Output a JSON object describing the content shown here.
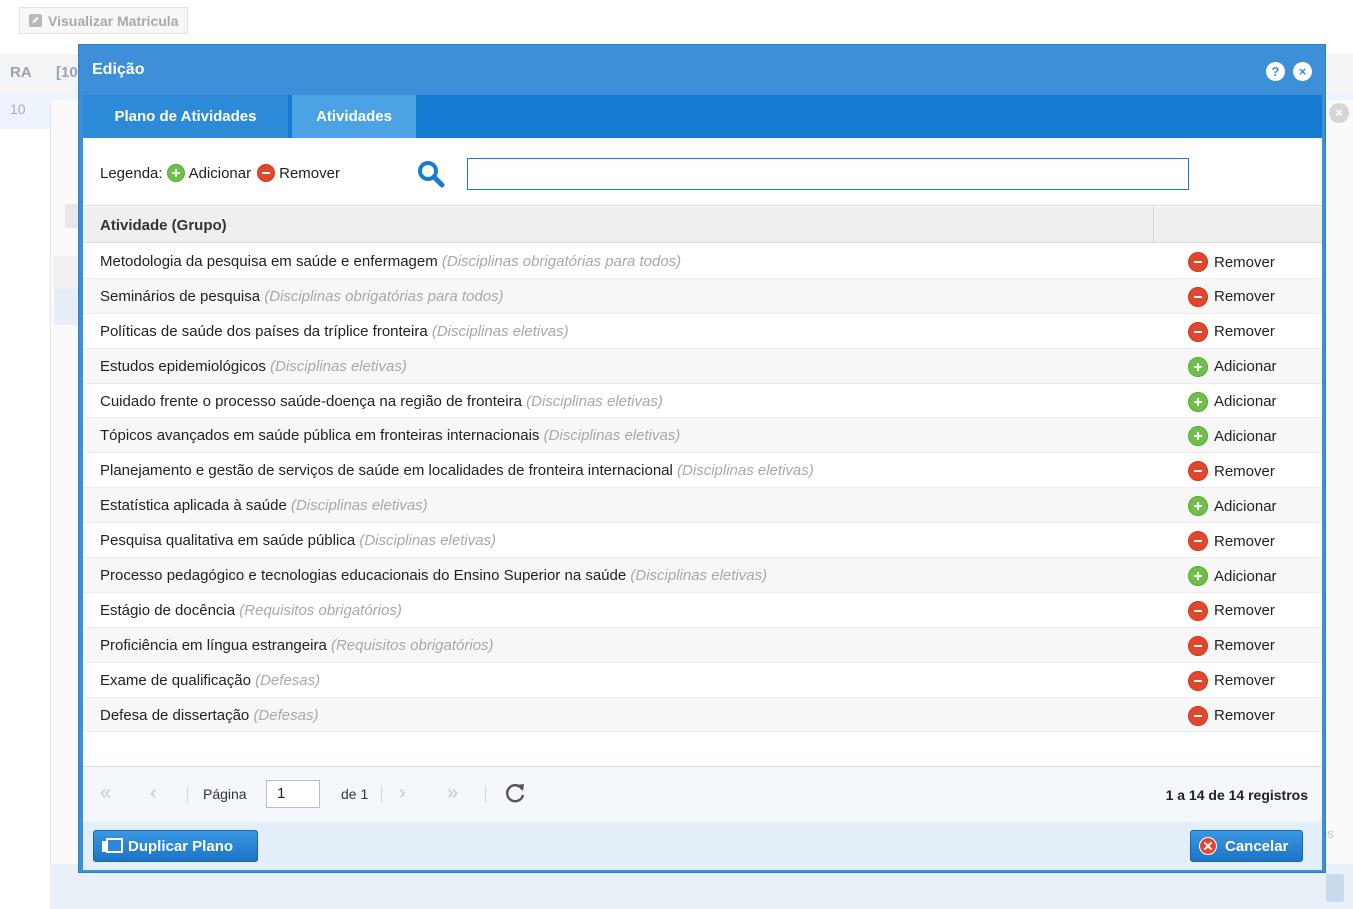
{
  "background": {
    "top_button_label": "Visualizar Matricula",
    "header_col1": "RA",
    "header_col2": "[10",
    "row_text": "10",
    "footer_text": "os"
  },
  "modal": {
    "title": "Edição",
    "help_icon": "?",
    "close_icon": "×"
  },
  "tabs": [
    {
      "label": "Plano de Atividades",
      "active": false
    },
    {
      "label": "Atividades",
      "active": true
    }
  ],
  "legend": {
    "label": "Legenda:",
    "add_label": "Adicionar",
    "remove_label": "Remover"
  },
  "search": {
    "value": "",
    "placeholder": ""
  },
  "grid": {
    "column_header": "Atividade (Grupo)",
    "rows": [
      {
        "name": "Metodologia da pesquisa em saúde e enfermagem",
        "group": "(Disciplinas obrigatórias para todos)",
        "action": "Remover"
      },
      {
        "name": "Seminários de pesquisa",
        "group": "(Disciplinas obrigatórias para todos)",
        "action": "Remover"
      },
      {
        "name": "Políticas de saúde dos países da tríplice fronteira",
        "group": "(Disciplinas eletivas)",
        "action": "Remover"
      },
      {
        "name": "Estudos epidemiológicos",
        "group": "(Disciplinas eletivas)",
        "action": "Adicionar"
      },
      {
        "name": "Cuidado frente o processo saúde-doença na região de fronteira",
        "group": "(Disciplinas eletivas)",
        "action": "Adicionar"
      },
      {
        "name": "Tópicos avançados em saúde pública em fronteiras internacionais",
        "group": "(Disciplinas eletivas)",
        "action": "Adicionar"
      },
      {
        "name": "Planejamento e gestão de serviços de saúde em localidades de fronteira internacional",
        "group": "(Disciplinas eletivas)",
        "action": "Remover"
      },
      {
        "name": "Estatística aplicada à saúde",
        "group": "(Disciplinas eletivas)",
        "action": "Adicionar"
      },
      {
        "name": "Pesquisa qualitativa em saúde pública",
        "group": "(Disciplinas eletivas)",
        "action": "Remover"
      },
      {
        "name": "Processo pedagógico e tecnologias educacionais do Ensino Superior na saúde",
        "group": "(Disciplinas eletivas)",
        "action": "Adicionar"
      },
      {
        "name": "Estágio de docência",
        "group": "(Requisitos obrigatórios)",
        "action": "Remover"
      },
      {
        "name": "Proficiência em língua estrangeira",
        "group": "(Requisitos obrigatórios)",
        "action": "Remover"
      },
      {
        "name": "Exame de qualificação",
        "group": "(Defesas)",
        "action": "Remover"
      },
      {
        "name": "Defesa de dissertação",
        "group": "(Defesas)",
        "action": "Remover"
      }
    ]
  },
  "pager": {
    "page_label": "Página",
    "page_value": "1",
    "of_label": "de 1",
    "record_count": "1 a 14 de 14 registros"
  },
  "footer": {
    "duplicate_label": "Duplicar Plano",
    "cancel_label": "Cancelar"
  },
  "colors": {
    "primary_blue": "#3d8fd8",
    "tab_bar": "#157bd0",
    "active_tab": "#4ba3e6",
    "add_green": "#6fbf4b",
    "remove_red": "#e2472c"
  }
}
